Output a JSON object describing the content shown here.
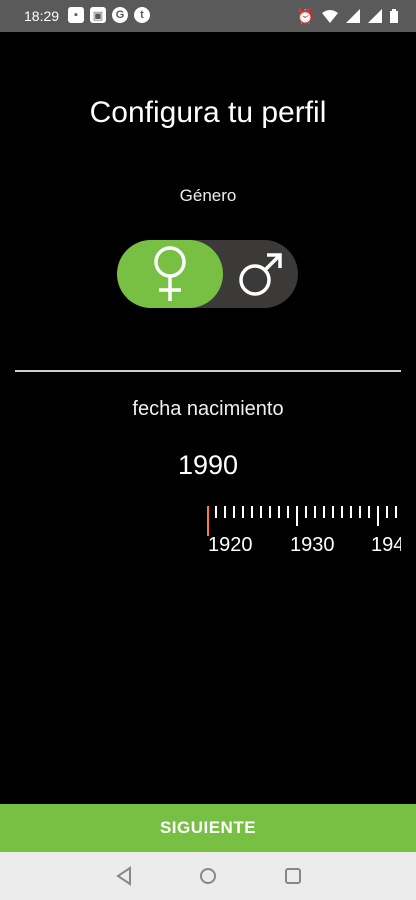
{
  "status_bar": {
    "time": "18:29",
    "icons_left": [
      "alert-icon",
      "photos-icon",
      "google-icon",
      "tumblr-icon"
    ],
    "icons_right": [
      "alarm-icon",
      "wifi-icon",
      "signal-icon",
      "signal-icon",
      "battery-icon"
    ]
  },
  "screen": {
    "title": "Configura tu perfil",
    "gender_label": "Género",
    "gender_selected": "female",
    "birth_label": "fecha nacimiento",
    "year_value": "1990",
    "ruler_labels": [
      "1920",
      "1930",
      "194"
    ]
  },
  "button": {
    "next_label": "SIGUIENTE"
  },
  "colors": {
    "accent": "#77c043",
    "indicator": "#ff7a33",
    "toggle_bg": "#3b3a38"
  }
}
